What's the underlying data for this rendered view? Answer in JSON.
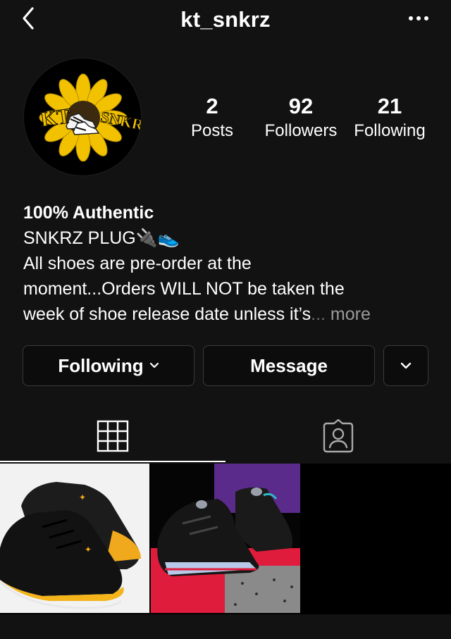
{
  "header": {
    "username": "kt_snkrz",
    "back_icon": "chevron-left-icon",
    "more_icon": "more-horizontal-icon"
  },
  "profile": {
    "avatar_text_left": "KT",
    "avatar_text_right": "SNKRZ",
    "stats": {
      "posts": {
        "value": "2",
        "label": "Posts"
      },
      "followers": {
        "value": "92",
        "label": "Followers"
      },
      "following": {
        "value": "21",
        "label": "Following"
      }
    }
  },
  "bio": {
    "name": "100% Authentic",
    "line1": "SNKRZ PLUG",
    "line1_emoji": "🔌👟",
    "line2": "All shoes are pre-order at the",
    "line3": "moment...Orders WILL NOT be taken the",
    "line4": "week of shoe release date unless it’s",
    "ellipsis": "...",
    "more": "more"
  },
  "actions": {
    "following_label": "Following",
    "message_label": "Message"
  },
  "tabs": {
    "grid_icon": "grid-icon",
    "tagged_icon": "tagged-person-icon",
    "active": "grid"
  },
  "colors": {
    "background": "#121212",
    "text": "#ffffff",
    "muted": "#9a9a9a",
    "button_border": "#3a3a3a",
    "sunflower": "#f2c200"
  }
}
